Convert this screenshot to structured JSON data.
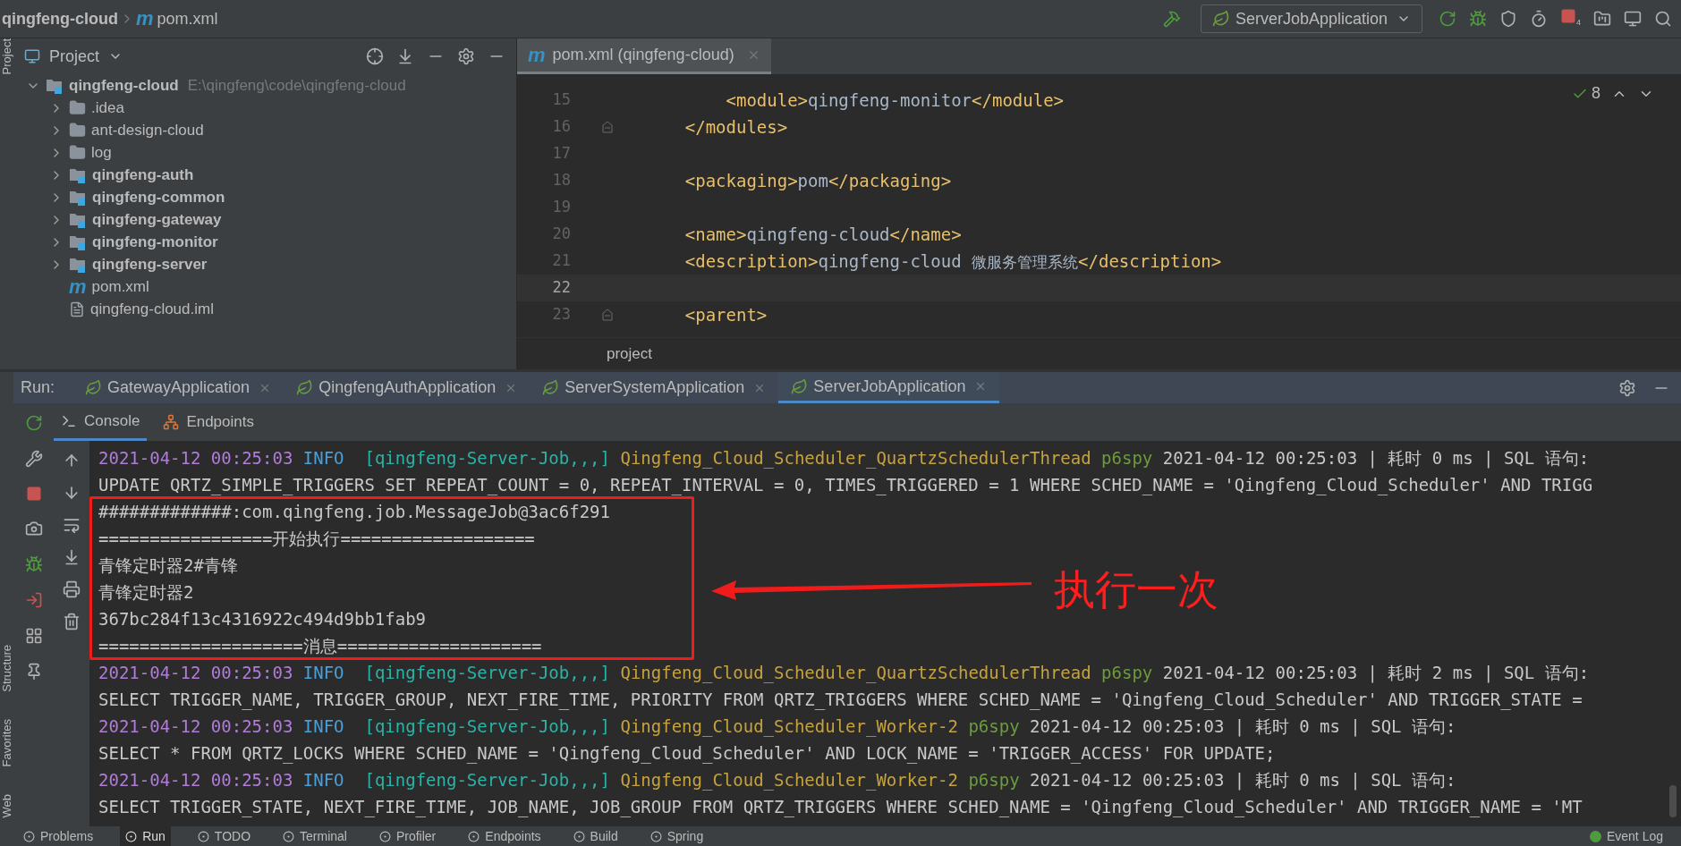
{
  "navbar": {
    "breadcrumb": [
      "qingfeng-cloud",
      "pom.xml"
    ],
    "file_glyph": "m",
    "run_config": "ServerJobApplication",
    "stop_badge": "4"
  },
  "side_stripe": {
    "top": [
      "Project"
    ],
    "bottom": [
      "Structure",
      "Favorites",
      "Web"
    ]
  },
  "project": {
    "title": "Project",
    "tree": [
      {
        "name": "qingfeng-cloud",
        "path": "E:\\qingfeng\\code\\qingfeng-cloud",
        "kind": "module",
        "expanded": true,
        "children": [
          {
            "name": ".idea",
            "kind": "folder",
            "expanded": false
          },
          {
            "name": "ant-design-cloud",
            "kind": "folder",
            "expanded": false
          },
          {
            "name": "log",
            "kind": "folder",
            "expanded": false
          },
          {
            "name": "qingfeng-auth",
            "kind": "module",
            "expanded": false
          },
          {
            "name": "qingfeng-common",
            "kind": "module",
            "expanded": false
          },
          {
            "name": "qingfeng-gateway",
            "kind": "module",
            "expanded": false
          },
          {
            "name": "qingfeng-monitor",
            "kind": "module",
            "expanded": false
          },
          {
            "name": "qingfeng-server",
            "kind": "module",
            "expanded": false
          },
          {
            "name": "pom.xml",
            "kind": "pom",
            "glyph": "m"
          },
          {
            "name": "qingfeng-cloud.iml",
            "kind": "iml"
          }
        ]
      }
    ]
  },
  "editor": {
    "tab_glyph": "m",
    "tab": "pom.xml (qingfeng-cloud)",
    "inspections": "8",
    "breadcrumb": "project",
    "lines": [
      {
        "number": "15",
        "current": false,
        "fold": false,
        "tokens": [
          {
            "kind": "tag",
            "text": "        <module>"
          },
          {
            "kind": "text",
            "text": "qingfeng-monitor"
          },
          {
            "kind": "tag",
            "text": "</module>"
          }
        ]
      },
      {
        "number": "16",
        "current": false,
        "fold": true,
        "tokens": [
          {
            "kind": "tag",
            "text": "    </modules>"
          }
        ]
      },
      {
        "number": "17",
        "current": false,
        "fold": false
      },
      {
        "number": "18",
        "current": false,
        "fold": false,
        "tokens": [
          {
            "kind": "tag",
            "text": "    <packaging>"
          },
          {
            "kind": "text",
            "text": "pom"
          },
          {
            "kind": "tag",
            "text": "</packaging>"
          }
        ]
      },
      {
        "number": "19",
        "current": false,
        "fold": false
      },
      {
        "number": "20",
        "current": false,
        "fold": false,
        "tokens": [
          {
            "kind": "tag",
            "text": "    <name>"
          },
          {
            "kind": "text",
            "text": "qingfeng-cloud"
          },
          {
            "kind": "tag",
            "text": "</name>"
          }
        ]
      },
      {
        "number": "21",
        "current": false,
        "fold": false,
        "tokens": [
          {
            "kind": "tag",
            "text": "    <description>"
          },
          {
            "kind": "text",
            "text": "qingfeng-cloud "
          },
          {
            "kind": "cjk",
            "text": "微服务管理系统"
          },
          {
            "kind": "tag",
            "text": "</description>"
          }
        ]
      },
      {
        "number": "22",
        "current": true,
        "fold": false
      },
      {
        "number": "23",
        "current": false,
        "fold": true,
        "tokens": [
          {
            "kind": "tag",
            "text": "    <parent>"
          }
        ]
      }
    ]
  },
  "run": {
    "label": "Run:",
    "tabs": [
      {
        "label": "GatewayApplication",
        "selected": false
      },
      {
        "label": "QingfengAuthApplication",
        "selected": false
      },
      {
        "label": "ServerSystemApplication",
        "selected": false
      },
      {
        "label": "ServerJobApplication",
        "selected": true
      }
    ],
    "subtabs": [
      {
        "label": "Console",
        "kind": "console",
        "selected": true
      },
      {
        "label": "Endpoints",
        "kind": "endpoints",
        "selected": false
      }
    ],
    "console": [
      {
        "kind": "log",
        "time": "2021-04-12 00:25:03",
        "level": "INFO",
        "thread": "[qingfeng-Server-Job,,,]",
        "logger": "Qingfeng_Cloud_Scheduler_QuartzSchedulerThread",
        "source": "p6spy",
        "message": "2021-04-12 00:25:03 | 耗时 0 ms | SQL 语句:"
      },
      {
        "kind": "plain",
        "text": "UPDATE QRTZ_SIMPLE_TRIGGERS SET REPEAT_COUNT = 0, REPEAT_INTERVAL = 0, TIMES_TRIGGERED = 1 WHERE SCHED_NAME = 'Qingfeng_Cloud_Scheduler' AND TRIGG"
      },
      {
        "kind": "plain",
        "text": "#############:com.qingfeng.job.MessageJob@3ac6f291"
      },
      {
        "kind": "plain",
        "text": "=================开始执行==================="
      },
      {
        "kind": "plain",
        "text": "青锋定时器2#青锋"
      },
      {
        "kind": "plain",
        "text": "青锋定时器2"
      },
      {
        "kind": "plain",
        "text": "367bc284f13c4316922c494d9bb1fab9"
      },
      {
        "kind": "plain",
        "text": "====================消息===================="
      },
      {
        "kind": "log",
        "time": "2021-04-12 00:25:03",
        "level": "INFO",
        "thread": "[qingfeng-Server-Job,,,]",
        "logger": "Qingfeng_Cloud_Scheduler_QuartzSchedulerThread",
        "source": "p6spy",
        "message": "2021-04-12 00:25:03 | 耗时 2 ms | SQL 语句:"
      },
      {
        "kind": "plain",
        "text": "SELECT TRIGGER_NAME, TRIGGER_GROUP, NEXT_FIRE_TIME, PRIORITY FROM QRTZ_TRIGGERS WHERE SCHED_NAME = 'Qingfeng_Cloud_Scheduler' AND TRIGGER_STATE ="
      },
      {
        "kind": "log",
        "time": "2021-04-12 00:25:03",
        "level": "INFO",
        "thread": "[qingfeng-Server-Job,,,]",
        "logger": "Qingfeng_Cloud_Scheduler_Worker-2",
        "source": "p6spy",
        "message": "2021-04-12 00:25:03 | 耗时 0 ms | SQL 语句:"
      },
      {
        "kind": "plain",
        "text": "SELECT * FROM QRTZ_LOCKS WHERE SCHED_NAME = 'Qingfeng_Cloud_Scheduler' AND LOCK_NAME = 'TRIGGER_ACCESS' FOR UPDATE;"
      },
      {
        "kind": "log",
        "time": "2021-04-12 00:25:03",
        "level": "INFO",
        "thread": "[qingfeng-Server-Job,,,]",
        "logger": "Qingfeng_Cloud_Scheduler_Worker-2",
        "source": "p6spy",
        "message": "2021-04-12 00:25:03 | 耗时 0 ms | SQL 语句:"
      },
      {
        "kind": "plain",
        "text": "SELECT TRIGGER_STATE, NEXT_FIRE_TIME, JOB_NAME, JOB_GROUP FROM QRTZ_TRIGGERS WHERE SCHED_NAME = 'Qingfeng_Cloud_Scheduler' AND TRIGGER_NAME = 'MT"
      }
    ],
    "annotation": "执行一次"
  },
  "status_bar": {
    "left": [
      {
        "label": "Problems",
        "selected": false
      },
      {
        "label": "Run",
        "selected": true
      },
      {
        "label": "TODO",
        "selected": false
      },
      {
        "label": "Terminal",
        "selected": false
      },
      {
        "label": "Profiler",
        "selected": false
      },
      {
        "label": "Endpoints",
        "selected": false
      },
      {
        "label": "Build",
        "selected": false
      },
      {
        "label": "Spring",
        "selected": false
      }
    ],
    "right": "Event Log"
  }
}
